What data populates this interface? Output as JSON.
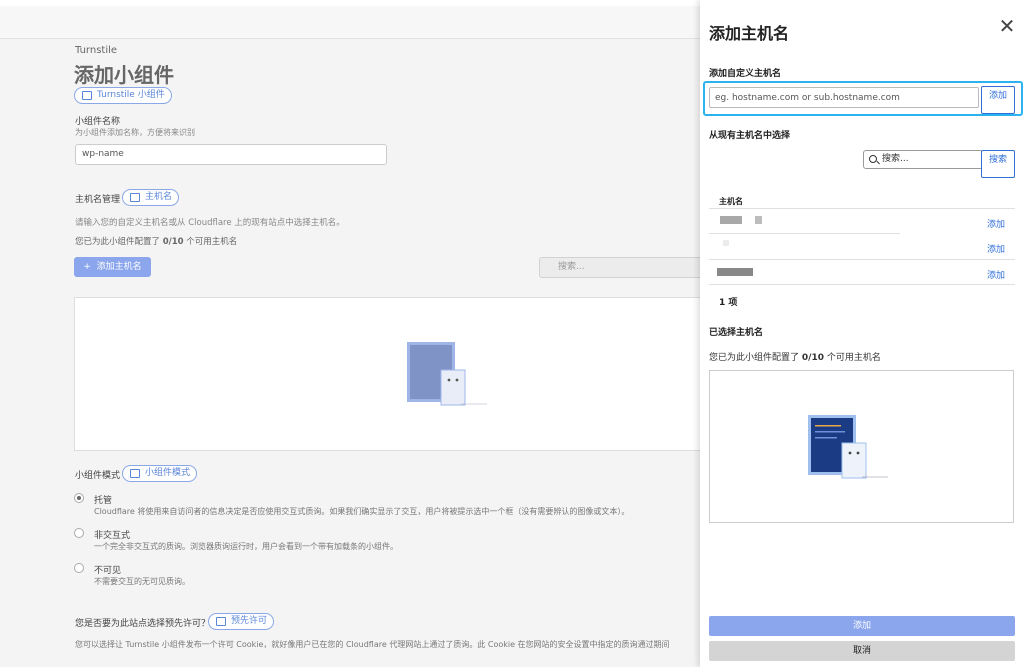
{
  "background": {
    "breadcrumb": "Turnstile",
    "page_title": "添加小组件",
    "doc_link_turnstile": "Turnstile 小组件",
    "widget_name_label": "小组件名称",
    "widget_name_help": "为小组件添加名称，方便将来识别",
    "widget_name_value": "wp-name",
    "hostname_mgmt_label": "主机名管理",
    "doc_link_hostname": "主机名",
    "hostname_help": "请输入您的自定义主机名或从 Cloudflare 上的现有站点中选择主机名。",
    "hostname_quota_prefix": "您已为此小组件配置了",
    "hostname_quota_value": "0/10",
    "hostname_quota_suffix": "个可用主机名",
    "add_hostname_button": "添加主机名",
    "search_placeholder": "搜索...",
    "widget_mode_label": "小组件模式",
    "doc_link_widget_mode": "小组件模式",
    "modes": [
      {
        "label": "托管",
        "desc": "Cloudflare 将使用来自访问者的信息决定是否应使用交互式质询。如果我们确实显示了交互，用户将被提示选中一个框（没有需要辨认的图像或文本）。",
        "selected": true
      },
      {
        "label": "非交互式",
        "desc": "一个完全非交互式的质询。浏览器质询运行时，用户会看到一个带有加载条的小组件。",
        "selected": false
      },
      {
        "label": "不可见",
        "desc": "不需要交互的无可见质询。",
        "selected": false
      }
    ],
    "preclearance_label": "您是否要为此站点选择预先许可？",
    "doc_link_preclearance": "预先许可",
    "preclearance_desc": "您可以选择让 Turnstile 小组件发布一个许可 Cookie，就好像用户已在您的 Cloudflare 代理网站上通过了质询。此 Cookie 在您网站的安全设置中指定的质询通过期间"
  },
  "panel": {
    "title": "添加主机名",
    "custom_section": "添加自定义主机名",
    "custom_placeholder": "eg. hostname.com or sub.hostname.com",
    "custom_add_button": "添加",
    "existing_section": "从现有主机名中选择",
    "existing_search_placeholder": "搜索...",
    "existing_search_button": "搜索",
    "table_header": "主机名",
    "rows": [
      {
        "add_label": "添加"
      },
      {
        "add_label": "添加"
      },
      {
        "add_label": "添加"
      }
    ],
    "row_count": "1 项",
    "selected_section": "已选择主机名",
    "selected_note_prefix": "您已为此小组件配置了",
    "selected_note_value": "0/10",
    "selected_note_suffix": "个可用主机名",
    "submit_button": "添加",
    "cancel_button": "取消"
  }
}
